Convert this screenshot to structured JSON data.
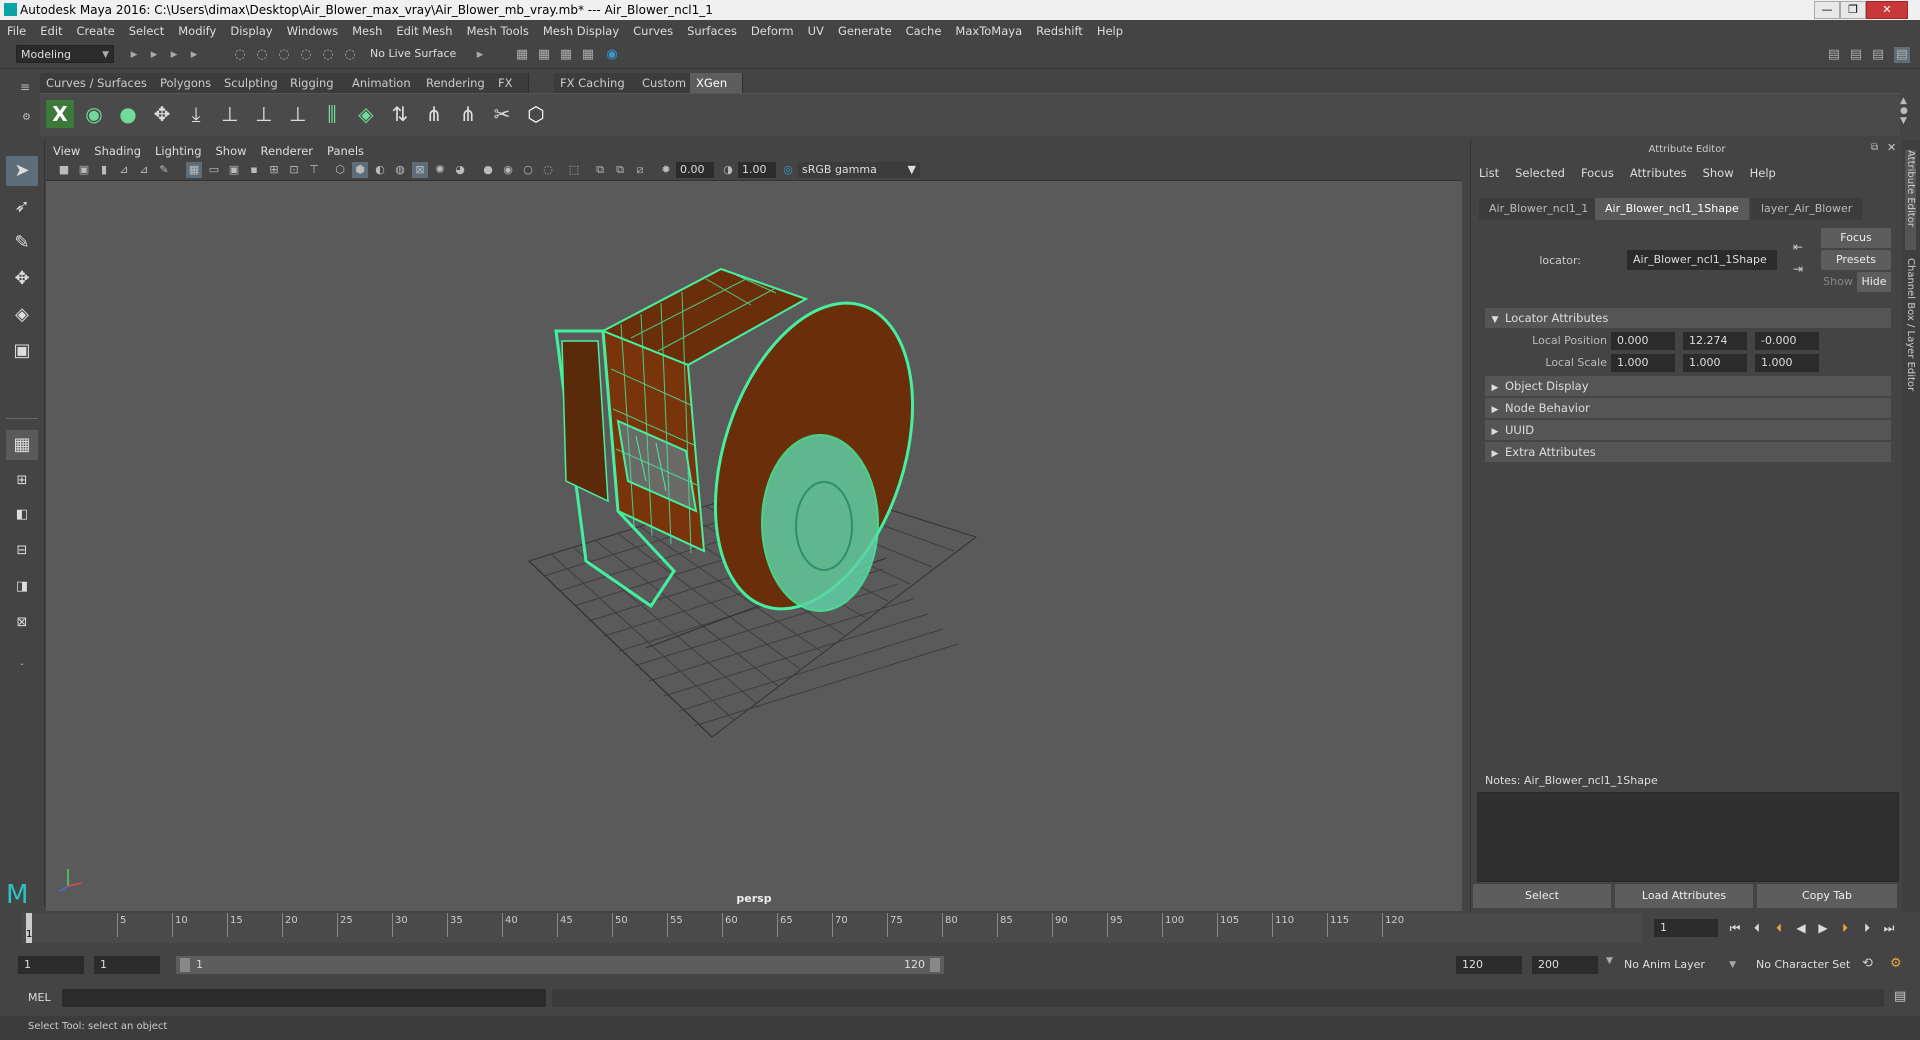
{
  "window": {
    "title": "Autodesk Maya 2016: C:\\Users\\dimax\\Desktop\\Air_Blower_max_vray\\Air_Blower_mb_vray.mb*   ---   Air_Blower_ncl1_1",
    "minimize": "—",
    "restore": "❐",
    "close": "✕"
  },
  "menubar": [
    "File",
    "Edit",
    "Create",
    "Select",
    "Modify",
    "Display",
    "Windows",
    "Mesh",
    "Edit Mesh",
    "Mesh Tools",
    "Mesh Display",
    "Curves",
    "Surfaces",
    "Deform",
    "UV",
    "Generate",
    "Cache",
    "MaxToMaya",
    "Redshift",
    "Help"
  ],
  "statusline": {
    "mode": "Modeling",
    "live_surface": "No Live Surface"
  },
  "shelf": {
    "tabs": [
      "Curves / Surfaces",
      "Polygons",
      "Sculpting",
      "Rigging",
      "Animation",
      "Rendering",
      "FX",
      "FX Caching",
      "Custom",
      "XGen"
    ],
    "active_tab": "XGen"
  },
  "viewport": {
    "menu": [
      "View",
      "Shading",
      "Lighting",
      "Show",
      "Renderer",
      "Panels"
    ],
    "near_value": "0.00",
    "far_value": "1.00",
    "color_space": "sRGB gamma",
    "camera_label": "persp"
  },
  "attribute_editor": {
    "title": "Attribute Editor",
    "menu": [
      "List",
      "Selected",
      "Focus",
      "Attributes",
      "Show",
      "Help"
    ],
    "tabs": [
      "Air_Blower_ncl1_1",
      "Air_Blower_ncl1_1Shape",
      "layer_Air_Blower"
    ],
    "active_tab": "Air_Blower_ncl1_1Shape",
    "node_label": "locator:",
    "node_name": "Air_Blower_ncl1_1Shape",
    "focus_button": "Focus",
    "presets_button": "Presets",
    "show_button": "Show",
    "hide_button": "Hide",
    "sections": {
      "locator": "Locator Attributes",
      "object_display": "Object Display",
      "node_behavior": "Node Behavior",
      "uuid": "UUID",
      "extra": "Extra Attributes"
    },
    "local_position": {
      "label": "Local Position",
      "x": "0.000",
      "y": "12.274",
      "z": "-0.000"
    },
    "local_scale": {
      "label": "Local Scale",
      "x": "1.000",
      "y": "1.000",
      "z": "1.000"
    },
    "notes_label": "Notes:  Air_Blower_ncl1_1Shape",
    "bottom_buttons": [
      "Select",
      "Load Attributes",
      "Copy Tab"
    ]
  },
  "side_tabs": {
    "attribute_editor": "Attribute Editor",
    "channel_box": "Channel Box / Layer Editor"
  },
  "timeline": {
    "ticks": [
      "5",
      "10",
      "15",
      "20",
      "25",
      "30",
      "35",
      "40",
      "45",
      "50",
      "55",
      "60",
      "65",
      "70",
      "75",
      "80",
      "85",
      "90",
      "95",
      "100",
      "105",
      "110",
      "115",
      "120"
    ],
    "start_label": "1",
    "current_frame": "1"
  },
  "range": {
    "start": "1",
    "playback_start": "1",
    "slider_start": "1",
    "slider_end": "120",
    "playback_end": "120",
    "end": "200",
    "anim_layer": "No Anim Layer",
    "character_set": "No Character Set"
  },
  "command_line": {
    "label": "MEL"
  },
  "help_line": "Select Tool: select an object"
}
